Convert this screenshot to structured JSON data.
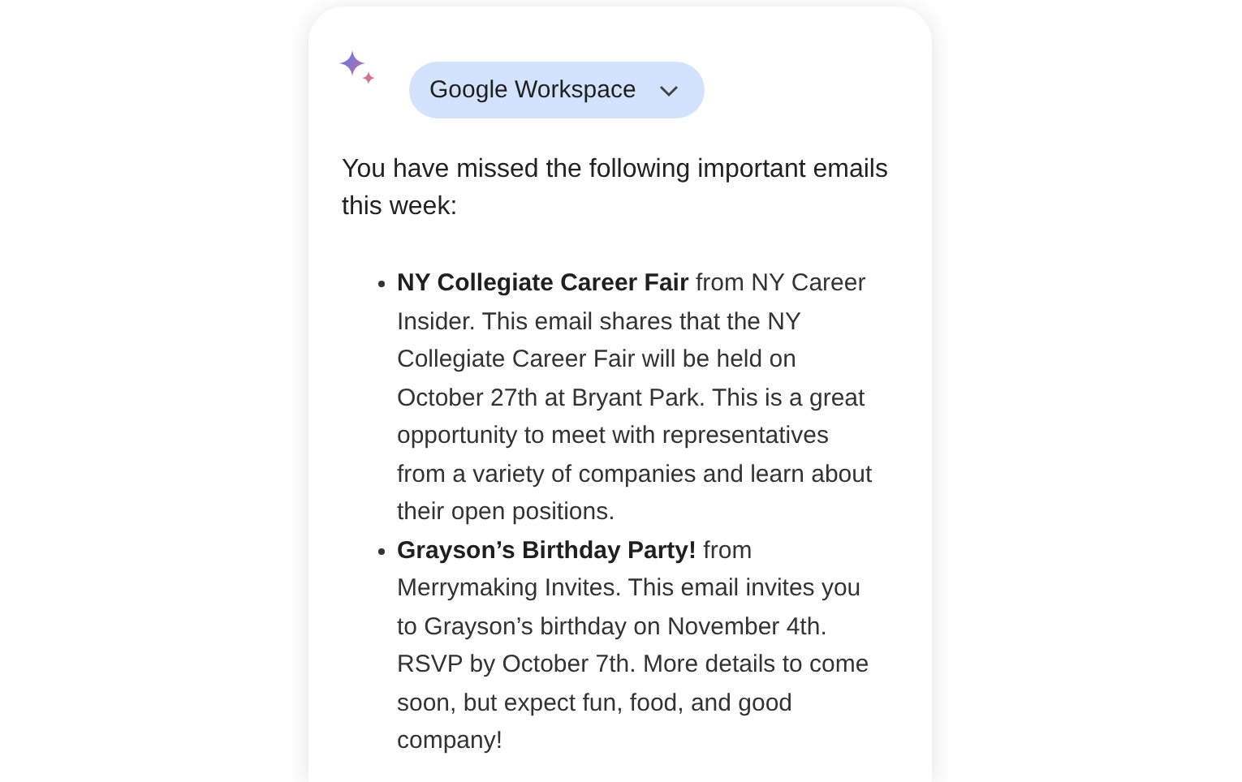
{
  "header": {
    "chip": {
      "label": "Google Workspace"
    }
  },
  "intro": "You have missed the following important emails this week:",
  "emails": [
    {
      "text": "**NY Collegiate Career Fair** from NY Career Insider. This email shares that the NY Collegiate Career Fair will be held on October 27th at Bryant Park. This is a great opportunity to meet with representatives from a variety of companies and learn about their open positions."
    },
    {
      "text": "**Grayson’s Birthday Party!** from Merrymaking Invites. This email invites you to Grayson’s birthday on November 4th. RSVP by October 7th. More details to come soon, but expect fun, food, and good company!"
    }
  ]
}
